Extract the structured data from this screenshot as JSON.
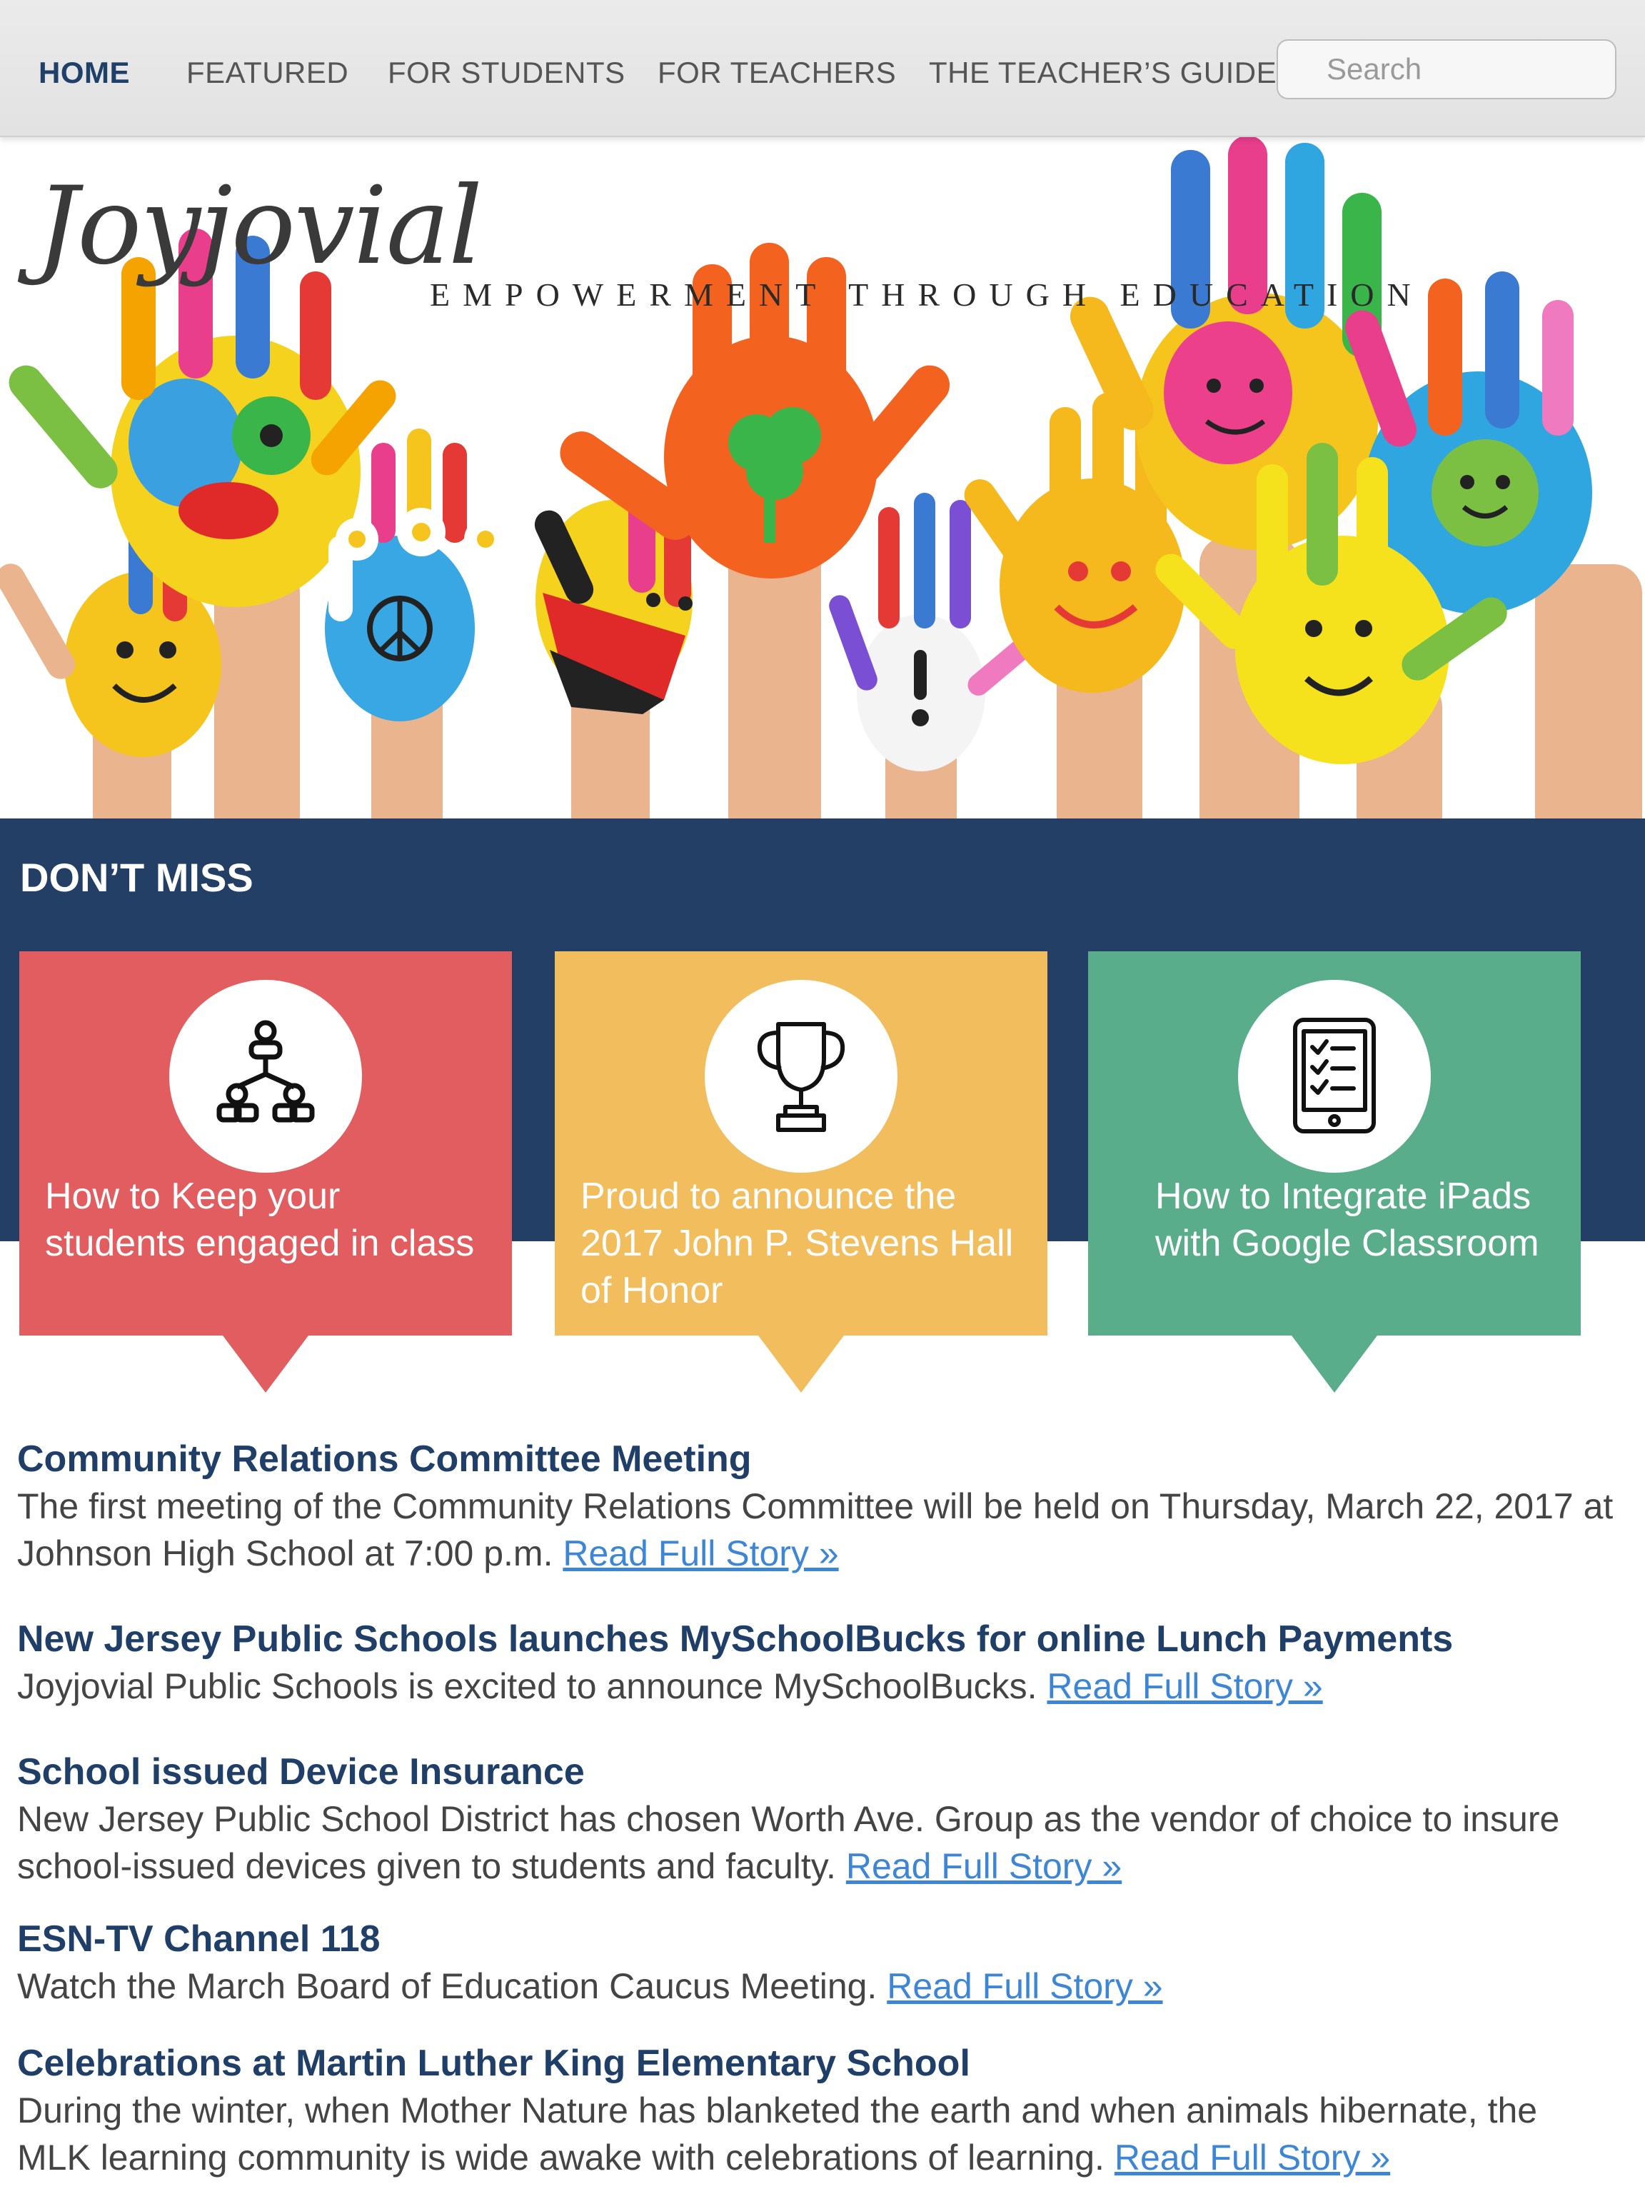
{
  "nav": {
    "items": [
      {
        "label": "HOME",
        "active": true
      },
      {
        "label": "FEATURED"
      },
      {
        "label": "FOR STUDENTS"
      },
      {
        "label": "FOR TEACHERS"
      },
      {
        "label": "THE TEACHER’S GUIDE"
      }
    ],
    "search_placeholder": "Search"
  },
  "hero": {
    "logo": "Joyjovial",
    "tagline": "EMPOWERMENT THROUGH EDUCATION"
  },
  "dont_miss": {
    "title": "DON’T MISS",
    "cards": [
      {
        "icon": "team-hierarchy-icon",
        "text": "How to Keep your students engaged in class",
        "color": "#e15d5f"
      },
      {
        "icon": "trophy-icon",
        "text": "Proud to announce the 2017 John P. Stevens Hall of Honor",
        "color": "#f2bd5c"
      },
      {
        "icon": "tablet-checklist-icon",
        "text": "How to Integrate iPads with Google Classroom",
        "color": "#5aad8a"
      }
    ]
  },
  "news": [
    {
      "title": "Community Relations Committee Meeting",
      "body": "The first meeting of the Community Relations Committee will be held on Thursday, March 22, 2017 at Johnson High School at 7:00 p.m.",
      "link": "Read Full Story »"
    },
    {
      "title": "New Jersey Public Schools launches MySchoolBucks for online Lunch Payments",
      "body": "Joyjovial Public Schools is excited to announce MySchoolBucks.",
      "link": "Read Full Story »"
    },
    {
      "title": "School issued Device Insurance",
      "body": "New Jersey Public School District has chosen Worth Ave. Group as the vendor of choice to insure school-issued devices given to students and faculty.",
      "link": "Read Full Story »"
    },
    {
      "title": "ESN-TV Channel 118",
      "body": "Watch the March Board of Education Caucus Meeting.",
      "link": "Read Full Story »"
    },
    {
      "title": "Celebrations at Martin Luther King Elementary School",
      "body": "During the winter, when Mother Nature has blanketed the earth and when animals hibernate, the MLK learning community is wide awake with celebrations of learning.",
      "link": "Read Full Story »"
    }
  ],
  "colors": {
    "nav_active": "#1f4069",
    "band": "#233f66",
    "link": "#3d86d6"
  }
}
